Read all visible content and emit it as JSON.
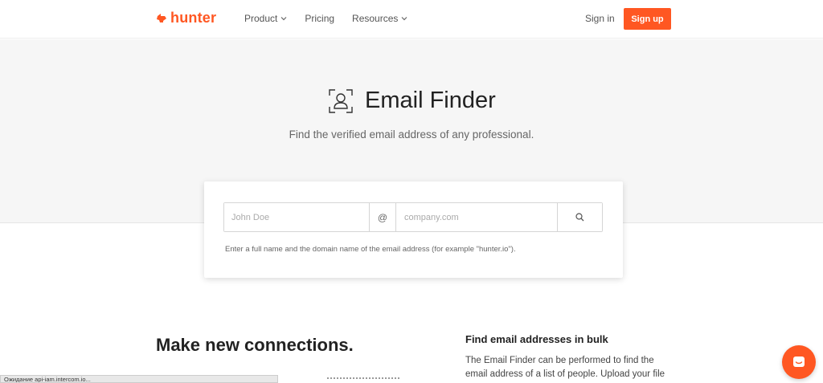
{
  "brand": {
    "name": "hunter",
    "color": "#ff5722"
  },
  "nav": {
    "items": [
      {
        "label": "Product",
        "has_dropdown": true
      },
      {
        "label": "Pricing",
        "has_dropdown": false
      },
      {
        "label": "Resources",
        "has_dropdown": true
      }
    ],
    "signin_label": "Sign in",
    "signup_label": "Sign up"
  },
  "hero": {
    "title": "Email Finder",
    "subtitle": "Find the verified email address of any professional."
  },
  "search": {
    "name_placeholder": "John Doe",
    "at_symbol": "@",
    "domain_placeholder": "company.com",
    "hint": "Enter a full name and the domain name of the email address (for example \"hunter.io\")."
  },
  "section": {
    "heading": "Make new connections.",
    "bulk_title": "Find email addresses in bulk",
    "bulk_text": "The Email Finder can be performed to find the email address of a list of people. Upload your file"
  },
  "status_bar": {
    "text": "Ожидание api-iam.intercom.io..."
  },
  "icons": {
    "logo": "hunter-logo-icon",
    "chevron": "chevron-down-icon",
    "finder": "person-frame-icon",
    "search": "search-icon",
    "chat": "chat-icon"
  }
}
